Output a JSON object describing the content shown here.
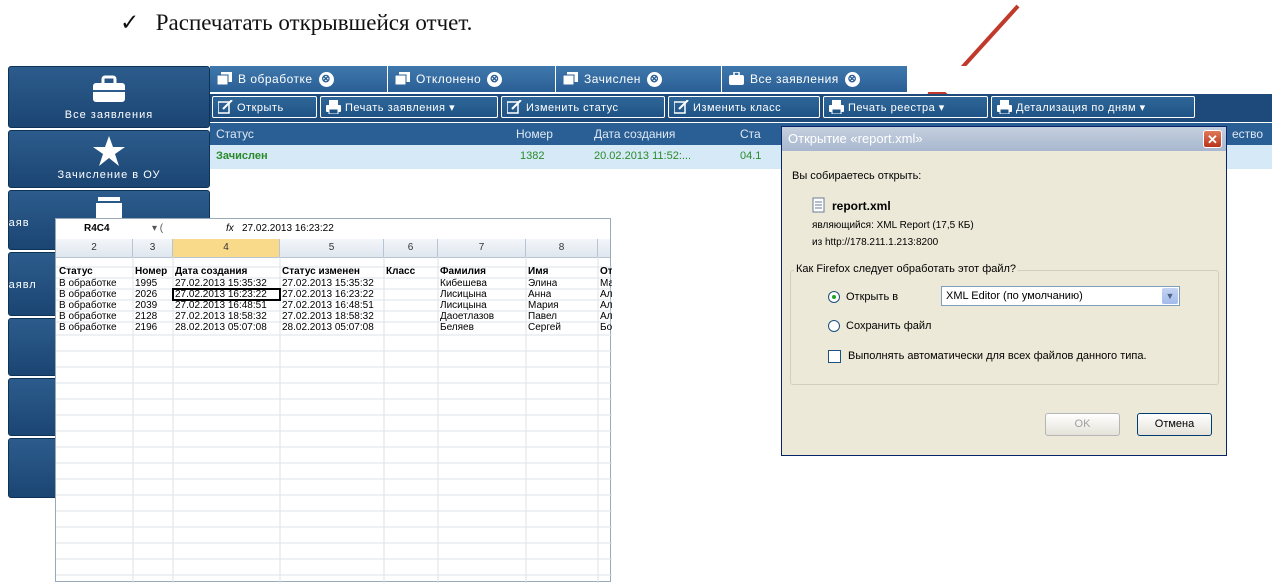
{
  "instruction": {
    "check": "✓",
    "text": "Распечатать открывшейся отчет."
  },
  "sidebar": {
    "items": [
      {
        "label": "Все заявления",
        "icon": "briefcase-icon"
      },
      {
        "label": "Зачисление в ОУ",
        "icon": "star-icon"
      },
      {
        "label": "Заяв",
        "icon": "stack-icon"
      },
      {
        "label": "Заявл",
        "icon": ""
      }
    ]
  },
  "tabs": [
    {
      "label": "В обработке"
    },
    {
      "label": "Отклонено"
    },
    {
      "label": "Зачислен"
    },
    {
      "label": "Все заявления"
    }
  ],
  "tab_close": "⊗",
  "toolbar": {
    "buttons": [
      {
        "label": "Открыть"
      },
      {
        "label": "Печать заявления ▾"
      },
      {
        "label": "Изменить статус"
      },
      {
        "label": "Изменить класс"
      },
      {
        "label": "Печать реестра ▾"
      },
      {
        "label": "Детализация по дням ▾"
      }
    ]
  },
  "grid": {
    "headers": [
      "Статус",
      "Номер",
      "Дата создания",
      "Ста",
      "ество"
    ],
    "row": [
      "Зачислен",
      "1382",
      "20.02.2013 11:52:...",
      "04.1"
    ]
  },
  "sheet": {
    "cell_ref": "R4C4",
    "fx": "fx",
    "formula": "27.02.2013 16:23:22",
    "col_numbers": [
      "2",
      "3",
      "4",
      "5",
      "6",
      "7",
      "8"
    ],
    "headers": [
      "Статус",
      "Номер",
      "Дата создания",
      "Статус изменен",
      "Класс",
      "Фамилия",
      "Имя",
      "Отчес"
    ],
    "rows": [
      [
        "В обработке",
        "1995",
        "27.02.2013 15:35:32",
        "27.02.2013 15:35:32",
        "",
        "Кибешева",
        "Элина",
        "Марат"
      ],
      [
        "В обработке",
        "2026",
        "27.02.2013 16:23:22",
        "27.02.2013 16:23:22",
        "",
        "Лисицына",
        "Анна",
        "Алекс"
      ],
      [
        "В обработке",
        "2039",
        "27.02.2013 16:48:51",
        "27.02.2013 16:48:51",
        "",
        "Лисицына",
        "Мария",
        "Алекс"
      ],
      [
        "В обработке",
        "2128",
        "27.02.2013 18:58:32",
        "27.02.2013 18:58:32",
        "",
        "Даоетлазов",
        "Павел",
        "Алекс"
      ],
      [
        "В обработке",
        "2196",
        "28.02.2013 05:07:08",
        "28.02.2013 05:07:08",
        "",
        "Беляев",
        "Сергей",
        "Борис"
      ]
    ]
  },
  "dialog": {
    "title": "Открытие «report.xml»",
    "close": "✕",
    "intro": "Вы собираетесь открыть:",
    "filename": "report.xml",
    "type_line": "являющийся:  XML Report (17,5 КБ)",
    "from_line": "из http://178.211.1.213:8200",
    "question": "Как Firefox следует обработать этот файл?",
    "open_with_label": "Открыть в",
    "open_with_value": "XML Editor (по умолчанию)",
    "save_label": "Сохранить файл",
    "auto_label": "Выполнять автоматически для всех файлов данного типа.",
    "ok": "OK",
    "cancel": "Отмена"
  },
  "colors": {
    "accent": "#2a5f95",
    "arrow": "#c0392b",
    "status_green": "#2a8a2a"
  }
}
